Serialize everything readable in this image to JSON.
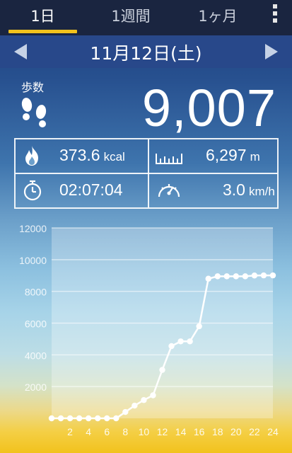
{
  "tabs": [
    {
      "label": "1日",
      "active": true
    },
    {
      "label": "1週間",
      "active": false
    },
    {
      "label": "1ヶ月",
      "active": false
    }
  ],
  "date": "11月12日(土)",
  "steps": {
    "label": "歩数",
    "value": "9,007"
  },
  "stats": {
    "calories": {
      "value": "373.6",
      "unit": "kcal"
    },
    "distance": {
      "value": "6,297",
      "unit": "m"
    },
    "time": {
      "value": "02:07:04"
    },
    "speed": {
      "value": "3.0",
      "unit": "km/h"
    }
  },
  "icons": {
    "steps": "footprints-icon",
    "calories": "flame-icon",
    "distance": "ruler-icon",
    "time": "stopwatch-icon",
    "speed": "speedometer-icon",
    "prev": "arrow-left-icon",
    "next": "arrow-right-icon",
    "menu": "more-vertical-icon"
  },
  "colors": {
    "accent": "#f2c21c",
    "header": "#1a2540",
    "date_bar": "#28488a"
  },
  "chart_data": {
    "type": "line",
    "title": "",
    "xlabel": "",
    "ylabel": "",
    "x": [
      0,
      1,
      2,
      3,
      4,
      5,
      6,
      7,
      8,
      9,
      10,
      11,
      12,
      13,
      14,
      15,
      16,
      17,
      18,
      19,
      20,
      21,
      22,
      23,
      24
    ],
    "values": [
      0,
      0,
      0,
      0,
      0,
      0,
      0,
      0,
      400,
      800,
      1150,
      1450,
      3050,
      4550,
      4850,
      4850,
      5800,
      8800,
      8950,
      8950,
      8950,
      8950,
      9000,
      9007,
      9007
    ],
    "xticks": [
      "2",
      "4",
      "6",
      "8",
      "10",
      "12",
      "14",
      "16",
      "18",
      "20",
      "22",
      "24"
    ],
    "yticks": [
      "2000",
      "4000",
      "6000",
      "8000",
      "10000",
      "12000"
    ],
    "ylim": [
      0,
      12000
    ],
    "xlim": [
      0,
      24
    ],
    "grid": true,
    "line_color": "#ffffff"
  }
}
